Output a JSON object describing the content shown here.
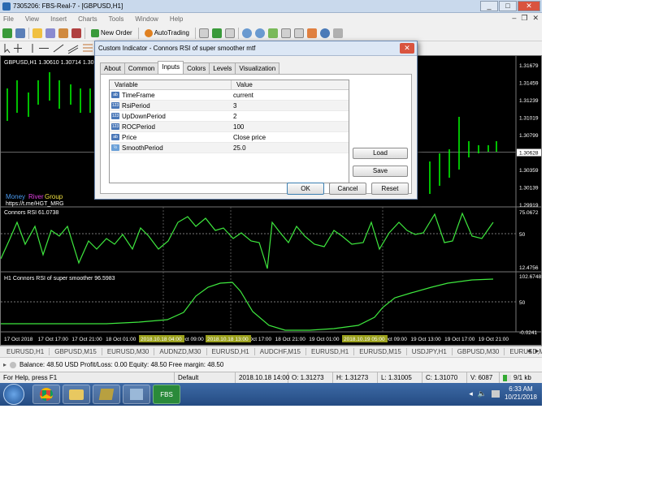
{
  "window": {
    "title": "7305206: FBS-Real-7 - [GBPUSD,H1]",
    "minimize": "_",
    "maximize": "□",
    "close": "✕"
  },
  "menu": [
    "File",
    "View",
    "Insert",
    "Charts",
    "Tools",
    "Window",
    "Help"
  ],
  "toolbar": {
    "new_order": "New Order",
    "autotrading": "AutoTrading"
  },
  "chart": {
    "symbol_header": "GBPUSD,H1  1.30610 1.30714 1.30",
    "price_axis": [
      "1.31679",
      "1.31459",
      "1.31239",
      "1.31019",
      "1.30799",
      "1.30628",
      "1.30359",
      "1.30139",
      "1.29919"
    ],
    "current_price": "1.30628",
    "watermark_1": "Money",
    "watermark_2": "River",
    "watermark_3": "Group",
    "watermark_url": "https://t.me/HGT_MRG",
    "sub1_label": "Connors RSI 61.0738",
    "sub1_axis": [
      "75.0672",
      "50",
      "12.4756"
    ],
    "sub2_label": "H1 Connors RSI of super smoother 96.5983",
    "sub2_axis": [
      "102.6748",
      "50",
      "-0.0241"
    ],
    "time_axis": [
      "17 Oct 2018",
      "17 Oct 17:00",
      "17 Oct 21:00",
      "18 Oct 01:00",
      "18 Oct 05:00",
      "18 Oct 09:00",
      "18 Oct 13:00",
      "18 Oct 17:00",
      "18 Oct 21:00",
      "19 Oct 01:00",
      "19 Oct 05:00",
      "19 Oct 09:00",
      "19 Oct 13:00",
      "19 Oct 17:00",
      "19 Oct 21:00"
    ],
    "time_highlights": [
      "2018.10.18 04:00",
      "2018.10.18 13:00",
      "2018.10.19 05:00"
    ]
  },
  "symbol_tabs": [
    "EURUSD,H1",
    "GBPUSD,M15",
    "EURUSD,M30",
    "AUDNZD,M30",
    "EURUSD,H1",
    "AUDCHF,M15",
    "EURUSD,H1",
    "EURUSD,M15",
    "USDJPY,H1",
    "GBPUSD,M30",
    "EURUSD,M15"
  ],
  "account": {
    "text": "Balance: 48.50 USD  Profit/Loss: 0.00  Equity: 48.50  Free margin: 48.50"
  },
  "status": {
    "help": "For Help, press F1",
    "profile": "Default",
    "datetime": "2018.10.18 14:00",
    "open": "O: 1.31273",
    "high": "H: 1.31273",
    "low": "L: 1.31005",
    "close": "C: 1.31070",
    "volume": "V: 6087",
    "connection": "9/1 kb"
  },
  "taskbar": {
    "fbs": "FBS",
    "time": "6:33 AM",
    "date": "10/21/2018"
  },
  "dialog": {
    "title": "Custom Indicator - Connors RSI of super smoother mtf",
    "close": "✕",
    "tabs": [
      "About",
      "Common",
      "Inputs",
      "Colors",
      "Levels",
      "Visualization"
    ],
    "active_tab": "Inputs",
    "col_variable": "Variable",
    "col_value": "Value",
    "params": [
      {
        "icon": "enum",
        "name": "TimeFrame",
        "value": "current"
      },
      {
        "icon": "int",
        "name": "RsiPeriod",
        "value": "3"
      },
      {
        "icon": "int",
        "name": "UpDownPeriod",
        "value": "2"
      },
      {
        "icon": "int",
        "name": "ROCPeriod",
        "value": "100"
      },
      {
        "icon": "enum",
        "name": "Price",
        "value": "Close price"
      },
      {
        "icon": "double",
        "name": "SmoothPeriod",
        "value": "25.0"
      }
    ],
    "load": "Load",
    "save": "Save",
    "ok": "OK",
    "cancel": "Cancel",
    "reset": "Reset"
  },
  "colors": {
    "candle": "#00ff00",
    "indicator": "#3ee83e",
    "chart_bg": "#000000",
    "highlight": "#9aa01c"
  }
}
